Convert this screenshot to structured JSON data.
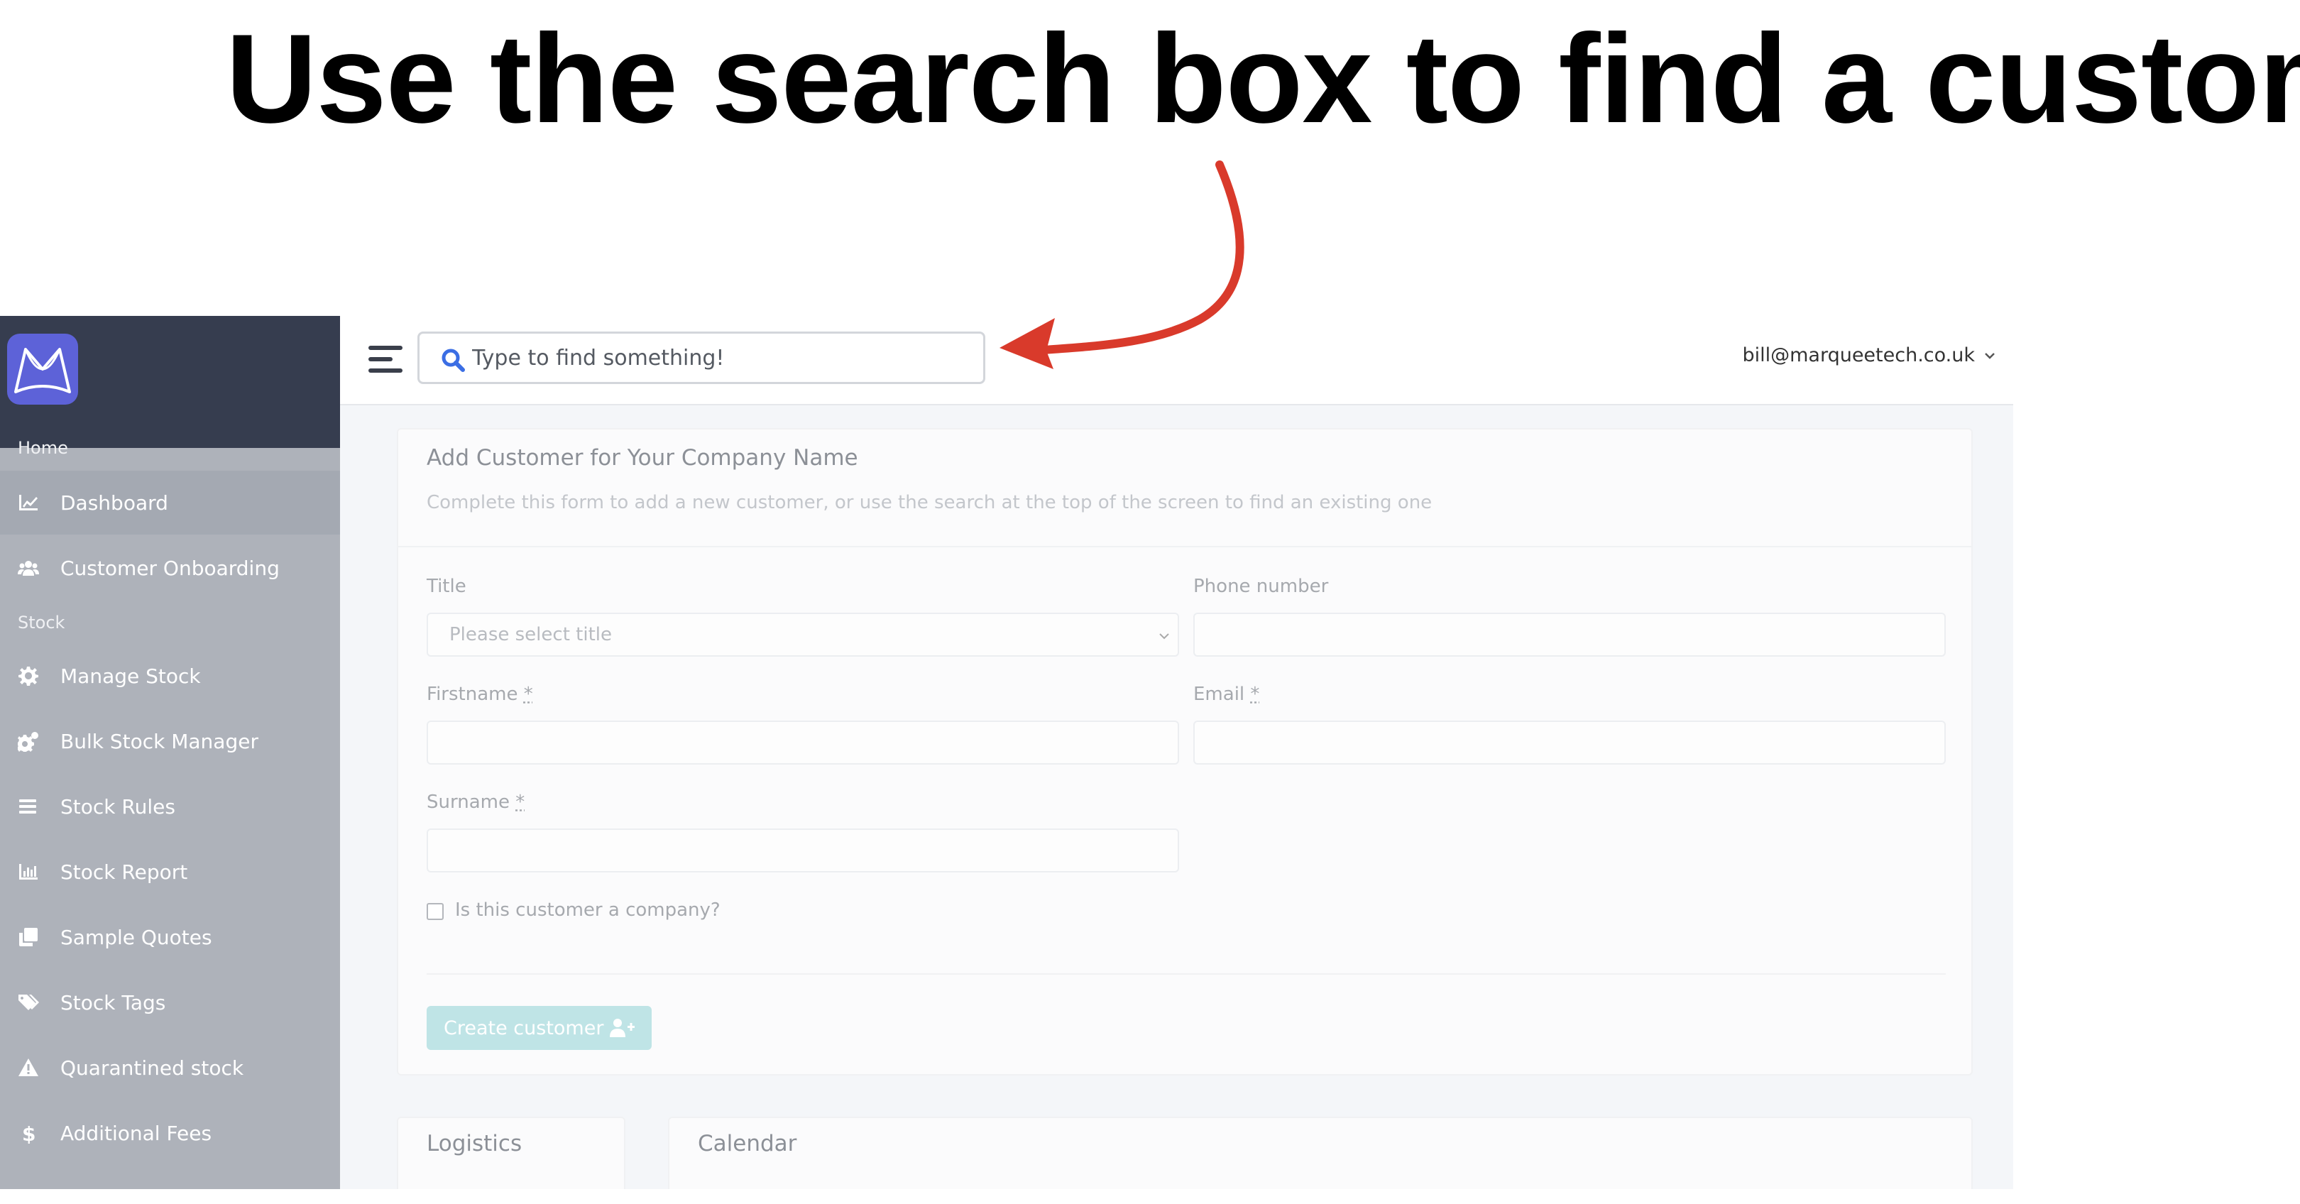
{
  "annotation": {
    "headline": "Use the search box to find a customer",
    "arrow_color": "#d93a2b"
  },
  "sidebar": {
    "logo_icon": "marquee-logo-icon",
    "sections": {
      "home": "Home",
      "stock": "Stock"
    },
    "items": [
      {
        "label": "Dashboard",
        "icon": "chart-line-icon",
        "active": true
      },
      {
        "label": "Customer Onboarding",
        "icon": "users-icon",
        "active": false
      },
      {
        "label": "Manage Stock",
        "icon": "gear-icon",
        "active": false
      },
      {
        "label": "Bulk Stock Manager",
        "icon": "gears-icon",
        "active": false
      },
      {
        "label": "Stock Rules",
        "icon": "list-icon",
        "active": false
      },
      {
        "label": "Stock Report",
        "icon": "bar-chart-icon",
        "active": false
      },
      {
        "label": "Sample Quotes",
        "icon": "copy-icon",
        "active": false
      },
      {
        "label": "Stock Tags",
        "icon": "tags-icon",
        "active": false
      },
      {
        "label": "Quarantined stock",
        "icon": "warning-icon",
        "active": false
      },
      {
        "label": "Additional Fees",
        "icon": "dollar-icon",
        "active": false
      }
    ],
    "colors": {
      "top": "#363d4f",
      "body": "#aeb2ba"
    }
  },
  "header": {
    "search_placeholder": "Type to find something!",
    "user_email": "bill@marqueetech.co.uk"
  },
  "form": {
    "title": "Add Customer for Your Company Name",
    "subtitle": "Complete this form to add a new customer, or use the search at the top of the screen to find an existing one",
    "fields": {
      "title_label": "Title",
      "title_placeholder": "Please select title",
      "phone_label": "Phone number",
      "firstname_label": "Firstname",
      "email_label": "Email",
      "surname_label": "Surname",
      "required_mark": "*"
    },
    "company_checkbox_label": "Is this customer a company?",
    "create_button": "Create customer"
  },
  "lower_cards": {
    "logistics": "Logistics",
    "calendar": "Calendar"
  }
}
